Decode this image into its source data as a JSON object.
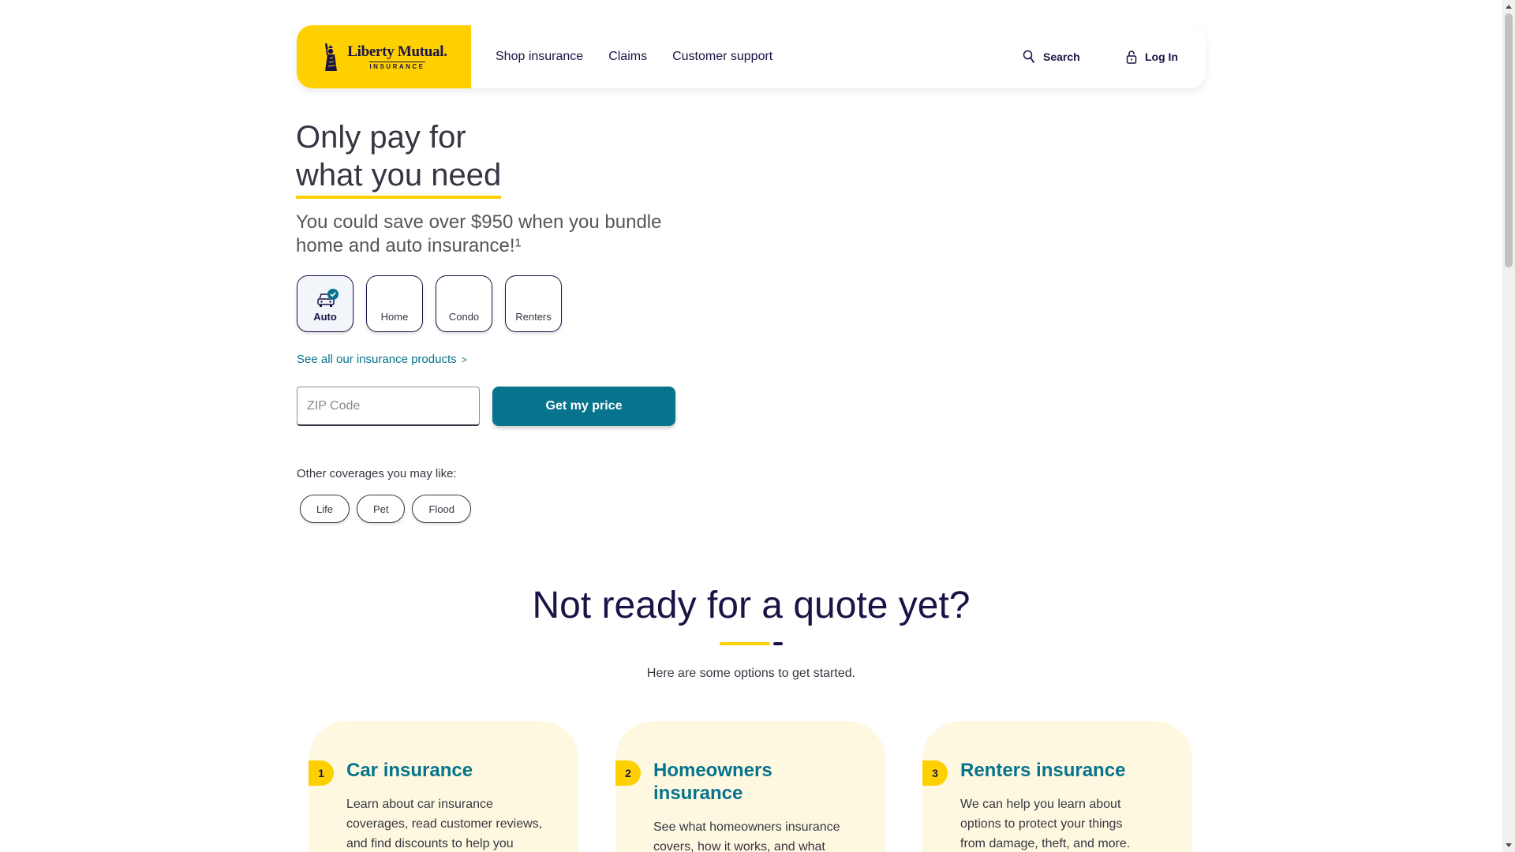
{
  "header": {
    "logo_name": "Liberty Mutual.",
    "logo_sub": "INSURANCE",
    "nav": [
      "Shop insurance",
      "Claims",
      "Customer support"
    ],
    "search_label": "Search",
    "login_label": "Log In"
  },
  "hero": {
    "title_line1": "Only pay for",
    "title_line2": "what you need",
    "subtitle": "You could save over $950 when you bundle home and auto insurance!¹",
    "products": [
      {
        "label": "Auto",
        "selected": true
      },
      {
        "label": "Home",
        "selected": false
      },
      {
        "label": "Condo",
        "selected": false
      },
      {
        "label": "Renters",
        "selected": false
      }
    ],
    "see_all": "See all our insurance products",
    "see_all_chevron": ">",
    "zip_placeholder": "ZIP Code",
    "cta_label": "Get my price",
    "other_label": "Other coverages you may like:",
    "other_chips": [
      "Life",
      "Pet",
      "Flood"
    ]
  },
  "section": {
    "title": "Not ready for a quote yet?",
    "subtitle": "Here are some options to get started.",
    "cards": [
      {
        "number": "1",
        "title": "Car insurance",
        "text": "Learn about car insurance coverages, read customer reviews, and find discounts to help you"
      },
      {
        "number": "2",
        "title": "Homeowners insurance",
        "text": "See what homeowners insurance covers, how it works, and what"
      },
      {
        "number": "3",
        "title": "Renters insurance",
        "text": "We can help you learn about options to protect your things from damage, theft, and more."
      }
    ]
  },
  "colors": {
    "brand_yellow": "#ffd000",
    "brand_navy": "#1a1446",
    "accent_teal": "#06748c",
    "card_bg": "#fff8e1"
  }
}
